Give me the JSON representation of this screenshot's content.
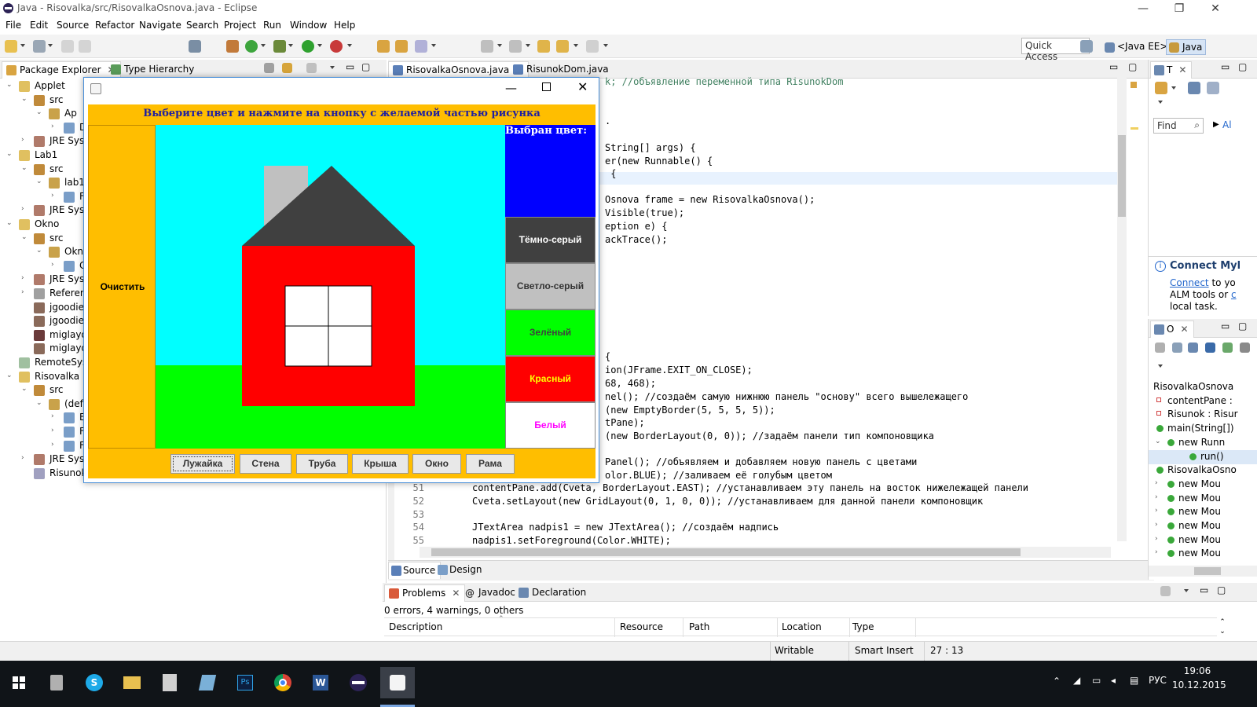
{
  "window": {
    "title": "Java - Risovalka/src/RisovalkaOsnova.java - Eclipse",
    "min": "—",
    "max": "❐",
    "close": "✕"
  },
  "menu": [
    "File",
    "Edit",
    "Source",
    "Refactor",
    "Navigate",
    "Search",
    "Project",
    "Run",
    "Window",
    "Help"
  ],
  "toolbar": {
    "quick_access": "Quick Access",
    "perspective_javaee": "<Java EE>",
    "perspective_java": "Java"
  },
  "left_panel": {
    "tabs": [
      {
        "label": "Package Explorer",
        "close": "✕"
      },
      {
        "label": "Type Hierarchy"
      }
    ],
    "tree": [
      {
        "label": "Applet"
      },
      {
        "label": "src"
      },
      {
        "label": "Ap"
      },
      {
        "label": "D"
      },
      {
        "label": "JRE Syst"
      },
      {
        "label": "Lab1"
      },
      {
        "label": "src"
      },
      {
        "label": "lab1"
      },
      {
        "label": "F"
      },
      {
        "label": "JRE Syst"
      },
      {
        "label": "Okno"
      },
      {
        "label": "src"
      },
      {
        "label": "Okn"
      },
      {
        "label": "C"
      },
      {
        "label": "JRE Syst"
      },
      {
        "label": "Referen"
      },
      {
        "label": "jgoodie"
      },
      {
        "label": "jgoodie"
      },
      {
        "label": "miglayo"
      },
      {
        "label": "miglayo"
      },
      {
        "label": "RemoteSyst"
      },
      {
        "label": "Risovalka"
      },
      {
        "label": "src"
      },
      {
        "label": "(defa"
      },
      {
        "label": "E"
      },
      {
        "label": "F"
      },
      {
        "label": "F"
      },
      {
        "label": "JRE Syst"
      },
      {
        "label": "Risunok"
      }
    ]
  },
  "editor": {
    "tabs": [
      {
        "label": "RisovalkaOsnova.java",
        "close": "✕"
      },
      {
        "label": "RisunokDom.java"
      }
    ],
    "partial_top": "k; //объявление переменной типа RisunokDom",
    "lines_partial": [
      ".",
      "String[] args) {",
      "er(new Runnable() {",
      " {",
      "Osnova frame = new RisovalkaOsnova();",
      "Visible(true);",
      "eption e) {",
      "ackTrace();",
      "{",
      "ion(JFrame.EXIT_ON_CLOSE);",
      "68, 468);",
      "nel(); //создаём самую нижнюю панель \"основу\" всего вышележащего",
      "(new EmptyBorder(5, 5, 5, 5));",
      "tPane);",
      "(new BorderLayout(0, 0)); //задаём панели тип компоновщика",
      "Panel(); //объявляем и добавляем новую панель с цветами",
      "olor.BLUE); //заливаем её голубым цветом"
    ],
    "lines_full": [
      {
        "n": "51",
        "text": "contentPane.add(Cveta, BorderLayout.EAST); //устанавливаем эту панель на восток нижележащей панели"
      },
      {
        "n": "52",
        "text": "Cveta.setLayout(new GridLayout(0, 1, 0, 0)); //устанавливаем для данной панели компоновщик"
      },
      {
        "n": "53",
        "text": ""
      },
      {
        "n": "54",
        "text": "JTextArea nadpis1 = new JTextArea(); //создаём надпись"
      },
      {
        "n": "55",
        "text": "nadpis1.setForeground(Color.WHITE);"
      }
    ],
    "bottom_tabs": [
      {
        "label": "Source"
      },
      {
        "label": "Design"
      }
    ]
  },
  "swing": {
    "header": "Выберите цвет и нажмите на кнопку с желаемой частью рисунка",
    "clear_button": "Очистить",
    "selected_label": "Выбран цвет:",
    "colors": [
      {
        "label": "Тёмно-серый",
        "bg": "#404040",
        "fg": "#ffffff"
      },
      {
        "label": "Светло-серый",
        "bg": "#c0c0c0",
        "fg": "#333333"
      },
      {
        "label": "Зелёный",
        "bg": "#00ff00",
        "fg": "#404040"
      },
      {
        "label": "Красный",
        "bg": "#ff0000",
        "fg": "#ffff00"
      },
      {
        "label": "Белый",
        "bg": "#ffffff",
        "fg": "#ff00ff"
      }
    ],
    "selected_color": "#0000ff",
    "buttons": [
      "Лужайка",
      "Стена",
      "Труба",
      "Крыша",
      "Окно",
      "Рама"
    ],
    "scene": {
      "sky": "#00ffff",
      "lawn": "#00ff00",
      "wall": "#ff0000",
      "roof": "#404040",
      "chimney": "#c0c0c0",
      "window": "#ffffff"
    }
  },
  "right_top": {
    "tab": "T",
    "find_placeholder": "Find",
    "all": "Al",
    "connect_title": "Connect Myl",
    "connect_link": "Connect",
    "connect_text1": "to yo",
    "connect_text2": "ALM tools or",
    "connect_link2": "c",
    "connect_text3": "local task."
  },
  "outline": {
    "tab": "O",
    "items": [
      "RisovalkaOsnova",
      "contentPane :",
      "Risunok : Risur",
      "main(String[])",
      "new Runn",
      "run()",
      "RisovalkaOsno",
      "new Mou",
      "new Mou",
      "new Mou",
      "new Mou",
      "new Mou",
      "new Mou"
    ]
  },
  "problems": {
    "tabs": [
      {
        "label": "Problems",
        "close": "✕"
      },
      {
        "label": "Javadoc"
      },
      {
        "label": "Declaration"
      }
    ],
    "summary": "0 errors, 4 warnings, 0 others",
    "columns": [
      "Description",
      "Resource",
      "Path",
      "Location",
      "Type"
    ]
  },
  "status": {
    "writable": "Writable",
    "insert": "Smart Insert",
    "position": "27 : 13"
  },
  "taskbar": {
    "lang": "РУС",
    "time": "19:06",
    "date": "10.12.2015"
  }
}
